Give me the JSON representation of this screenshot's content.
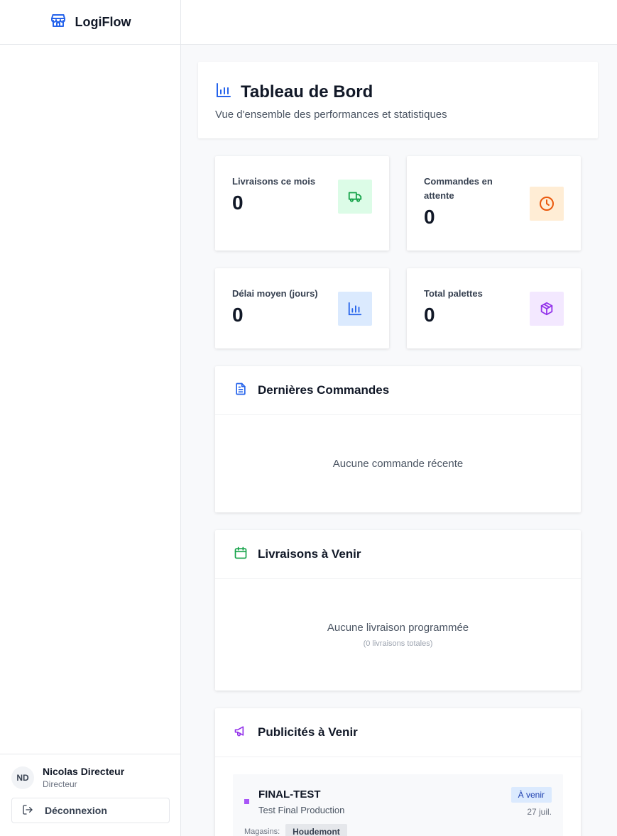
{
  "app": {
    "name": "LogiFlow"
  },
  "user": {
    "initials": "ND",
    "name": "Nicolas Directeur",
    "role": "Directeur",
    "logout_label": "Déconnexion"
  },
  "header": {
    "title": "Tableau de Bord",
    "subtitle": "Vue d'ensemble des performances et statistiques"
  },
  "stats": [
    {
      "label": "Livraisons ce mois",
      "value": "0",
      "icon": "truck-icon",
      "color": "#16a34a",
      "bg": "#dcfce7"
    },
    {
      "label": "Commandes en attente",
      "value": "0",
      "icon": "clock-icon",
      "color": "#ea580c",
      "bg": "#ffedd5"
    },
    {
      "label": "Délai moyen (jours)",
      "value": "0",
      "icon": "bar-chart-icon",
      "color": "#2563eb",
      "bg": "#dbeafe"
    },
    {
      "label": "Total palettes",
      "value": "0",
      "icon": "package-icon",
      "color": "#9333ea",
      "bg": "#f3e8ff"
    }
  ],
  "recent_orders": {
    "title": "Dernières Commandes",
    "empty": "Aucune commande récente"
  },
  "upcoming_deliveries": {
    "title": "Livraisons à Venir",
    "empty": "Aucune livraison programmée",
    "total_note": "(0 livraisons totales)"
  },
  "upcoming_ads": {
    "title": "Publicités à Venir",
    "items": [
      {
        "name": "FINAL-TEST",
        "description": "Test Final Production",
        "status": "À venir",
        "date": "27 juil.",
        "stores_label": "Magasins:",
        "stores": [
          "Houdemont"
        ]
      }
    ]
  },
  "colors": {
    "brand": "#2563eb",
    "sidebar_border": "#e5e7eb"
  }
}
